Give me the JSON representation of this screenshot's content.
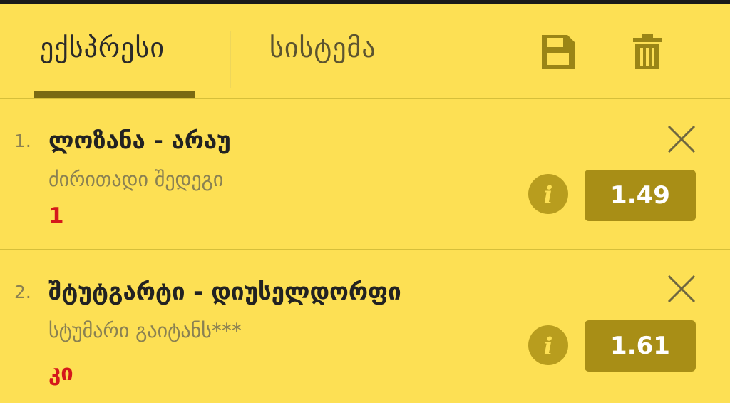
{
  "header": {
    "tabs": [
      {
        "label": "ექსპრესი",
        "active": true
      },
      {
        "label": "სისტემა",
        "active": false
      }
    ],
    "icons": {
      "save": "save-icon",
      "trash": "trash-icon"
    }
  },
  "bets": [
    {
      "index": "1.",
      "teams": "ლოზანა - არაუ",
      "market": "ძირითადი შედეგი",
      "pick": "1",
      "odds": "1.49"
    },
    {
      "index": "2.",
      "teams": "შტუტგარტი - დიუსელდორფი",
      "market": "სტუმარი გაიტანს***",
      "pick": "კი",
      "odds": "1.61"
    }
  ],
  "colors": {
    "background": "#fde054",
    "accent": "#a88e16",
    "pick": "#d4191b",
    "tab_underline": "#7a6a12"
  }
}
